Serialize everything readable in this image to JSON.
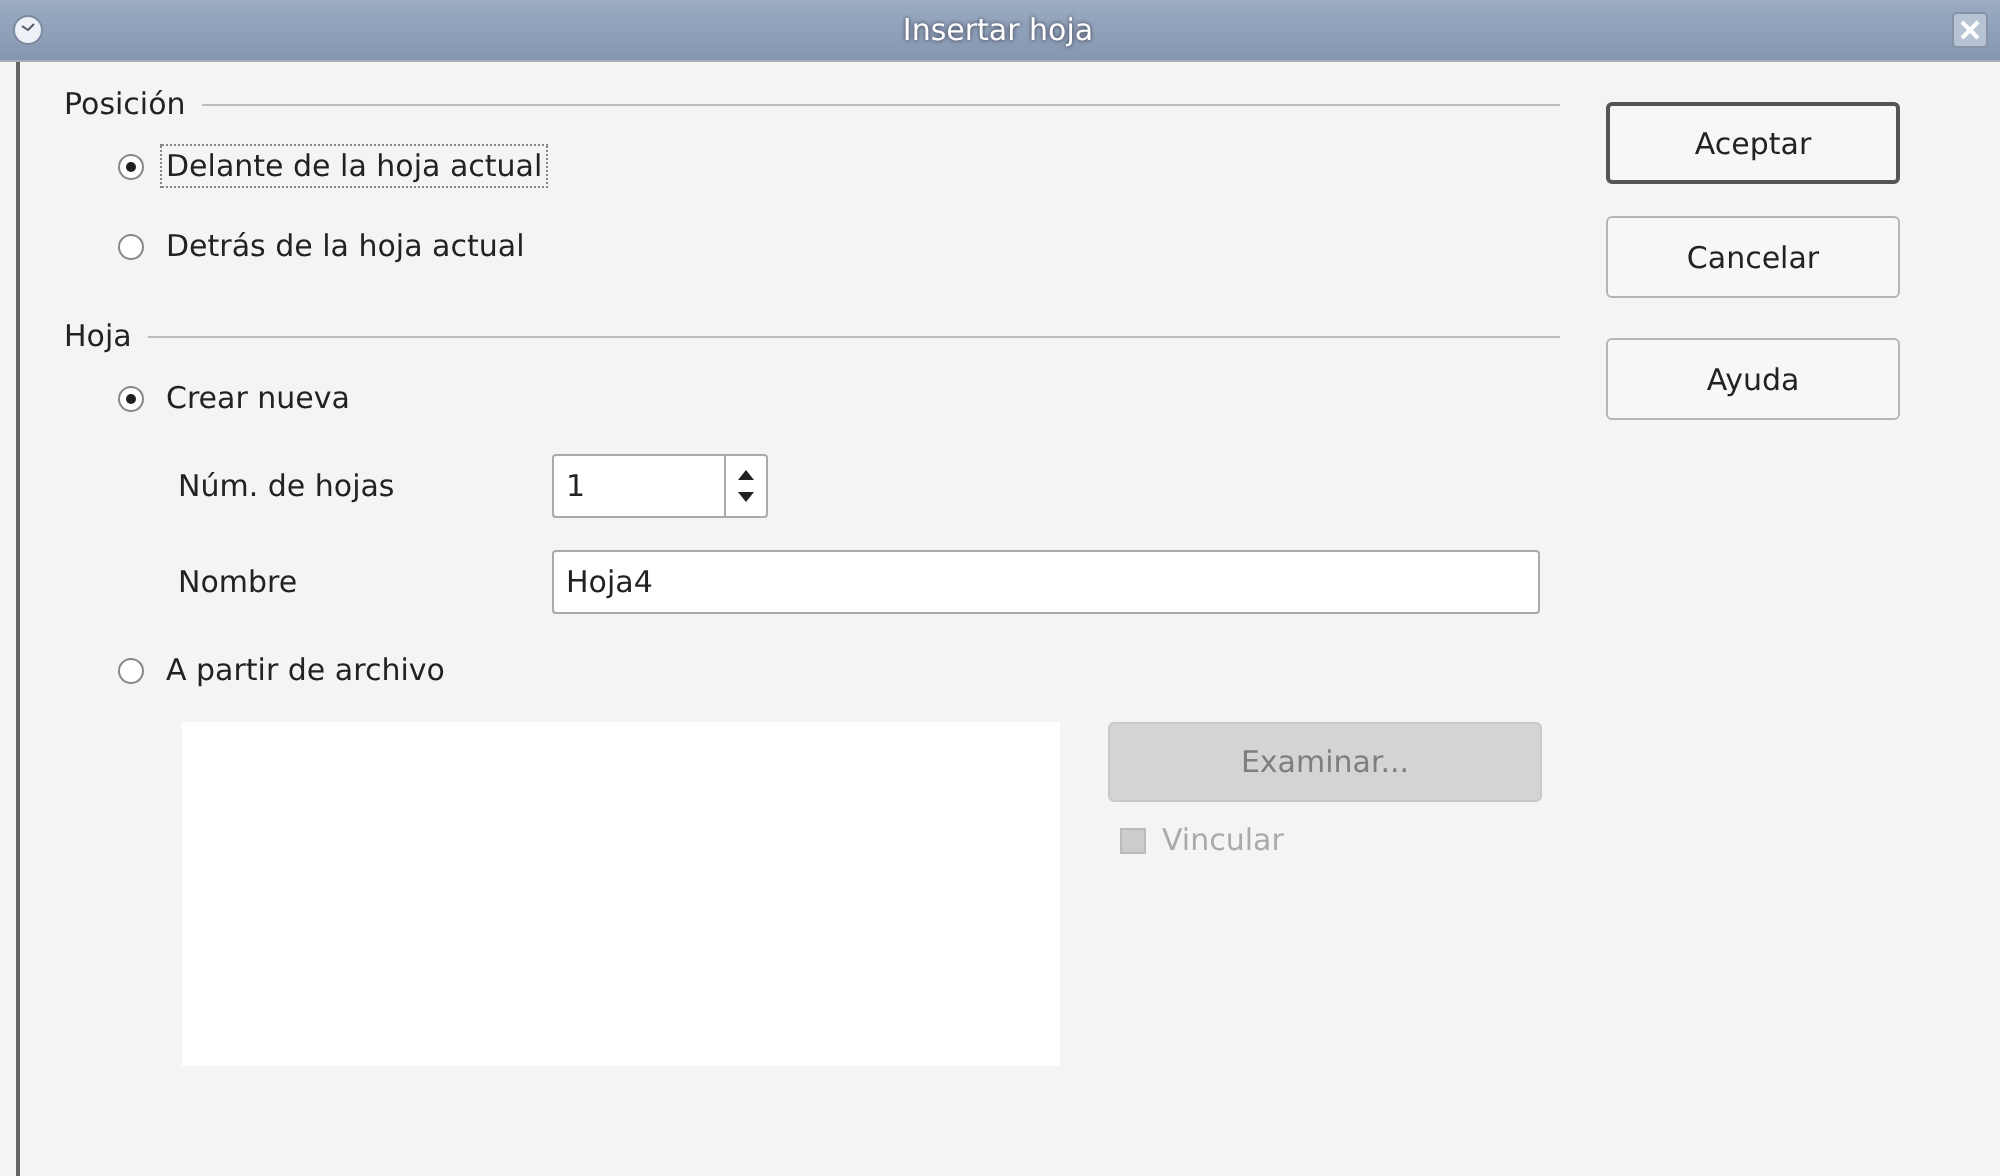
{
  "window": {
    "title": "Insertar hoja"
  },
  "position": {
    "label": "Posición",
    "options": [
      {
        "label": "Delante de la hoja actual",
        "selected": true,
        "focused": true
      },
      {
        "label": "Detrás de la hoja actual",
        "selected": false,
        "focused": false
      }
    ]
  },
  "sheet": {
    "label": "Hoja",
    "create_new": {
      "label": "Crear nueva",
      "selected": true
    },
    "count": {
      "label": "Núm. de hojas",
      "value": "1"
    },
    "name": {
      "label": "Nombre",
      "value": "Hoja4"
    },
    "from_file": {
      "label": "A partir de archivo",
      "selected": false
    },
    "browse": {
      "label": "Examinar...",
      "disabled": true
    },
    "link": {
      "label": "Vincular",
      "checked": false,
      "disabled": true
    }
  },
  "buttons": [
    {
      "label": "Aceptar",
      "default": true
    },
    {
      "label": "Cancelar",
      "default": false
    },
    {
      "label": "Ayuda",
      "default": false
    }
  ]
}
